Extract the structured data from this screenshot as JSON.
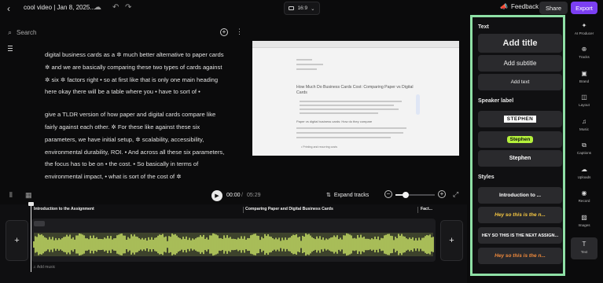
{
  "header": {
    "project_title": "cool video | Jan 8, 2025...",
    "aspect_ratio": "16:9",
    "feedback_label": "Feedback",
    "share_label": "Share",
    "export_label": "Export",
    "export_color": "#7b3ff2"
  },
  "search": {
    "placeholder": "Search"
  },
  "transcript": {
    "paragraphs": [
      "digital business cards as a ✲ much better alternative to paper cards ✲ and we are basically comparing these two types of cards against ✲ six ✲ factors right • so at first like that is only one main heading here okay there will be a table where you • have to sort of •",
      "give a TLDR version of how paper and digital cards compare like fairly against each other. ✲ For these like against these six parameters, we have initial setup, ✲ scalability, accessibility, environmental durability, ROI. • And across all these six parameters, the focus has to be on • the cost. • So basically in terms of environmental impact, • what is sort of the cost of ✲"
    ]
  },
  "preview": {
    "doc_title": "How Much Do Business Cards Cost: Comparing Paper vs Digital Cards",
    "doc_subheading": "Paper vs digital business cards: How do they compare",
    "doc_list_item": "• Printing and recurring costs"
  },
  "playback": {
    "current_time": "00:00",
    "separator": "/",
    "total_time": "05:29",
    "expand_label": "Expand tracks",
    "zoom_level": 0.25
  },
  "timeline": {
    "chapters": [
      "Introduction to the Assignment",
      "Comparing Paper and Digital Business Cards",
      "Fact..."
    ],
    "add_music_label": "Add music",
    "waveform_color": "#d7f26b"
  },
  "panel": {
    "text_section": "Text",
    "add_title": "Add title",
    "add_subtitle": "Add subtitle",
    "add_text": "Add text",
    "speaker_section": "Speaker label",
    "speaker_labels": [
      "STEPHEN",
      "Stephen",
      "Stephen"
    ],
    "styles_section": "Styles",
    "styles": [
      {
        "text": "Introduction to ...",
        "color": "#ffffff"
      },
      {
        "text": "Hey so this is the n...",
        "color": "#f7c842"
      },
      {
        "text": "HEY SO THIS IS THE NEXT ASSIGN...",
        "color": "#ffffff"
      },
      {
        "text": "Hey so this is the n...",
        "color": "#f08a3c"
      }
    ],
    "panel_border_color": "#8fe0a6"
  },
  "sidebar": {
    "items": [
      {
        "label": "AI Producer",
        "icon": "sparkle-icon"
      },
      {
        "label": "Tracks",
        "icon": "tracks-icon"
      },
      {
        "label": "Brand",
        "icon": "brand-icon"
      },
      {
        "label": "Layout",
        "icon": "layout-icon"
      },
      {
        "label": "Music",
        "icon": "music-icon"
      },
      {
        "label": "Captions",
        "icon": "captions-icon"
      },
      {
        "label": "Uploads",
        "icon": "upload-icon"
      },
      {
        "label": "Record",
        "icon": "record-icon"
      },
      {
        "label": "Images",
        "icon": "images-icon"
      },
      {
        "label": "Text",
        "icon": "text-icon"
      }
    ]
  }
}
